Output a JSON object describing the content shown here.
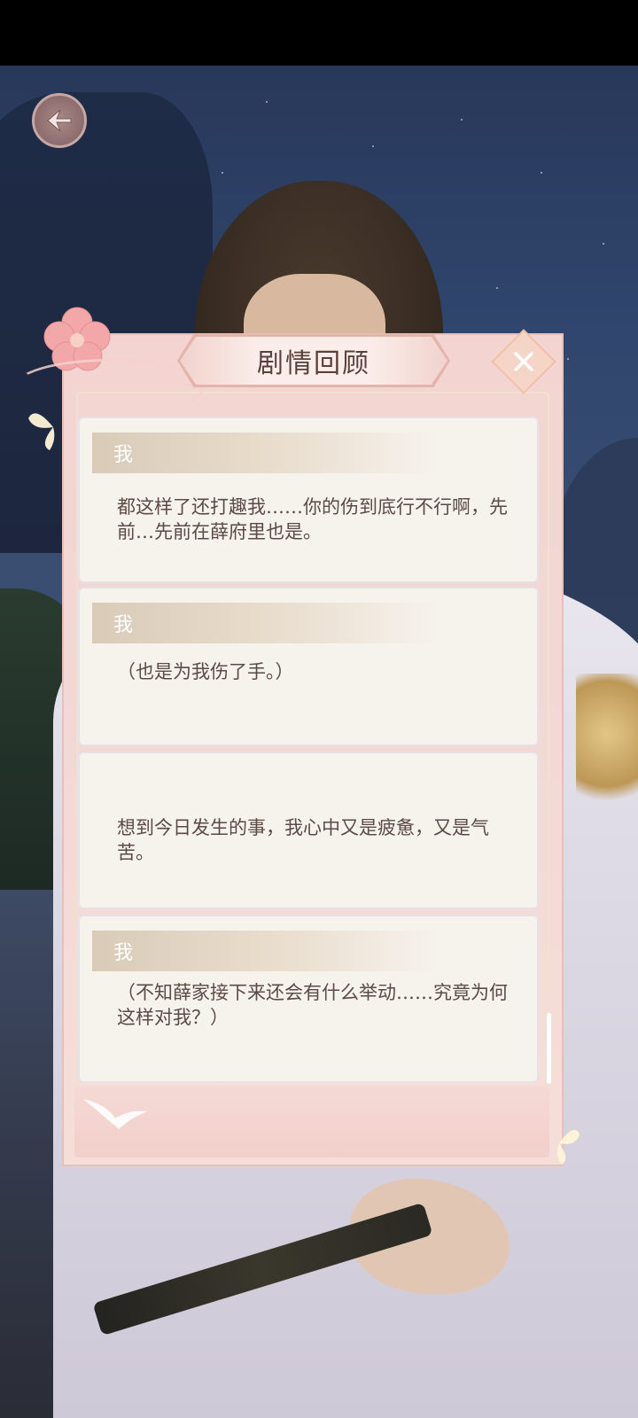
{
  "header": {
    "title": "剧情回顾"
  },
  "dialogue": [
    {
      "speaker": "我",
      "text": "都这样了还打趣我……你的伤到底行不行啊，先前…先前在薛府里也是。"
    },
    {
      "speaker": "我",
      "text": "（也是为我伤了手。）"
    },
    {
      "speaker": "",
      "text": "想到今日发生的事，我心中又是疲惫，又是气苦。"
    },
    {
      "speaker": "我",
      "text": "（不知薛家接下来还会有什么举动……究竟为何这样对我？）"
    }
  ],
  "icons": {
    "back": "back-arrow-icon",
    "close": "close-icon"
  },
  "colors": {
    "panel_pink": "#f3d4d0",
    "card_bg": "#f6f2ec",
    "title_text": "#5a3f3a",
    "body_text": "#5b4b44"
  }
}
